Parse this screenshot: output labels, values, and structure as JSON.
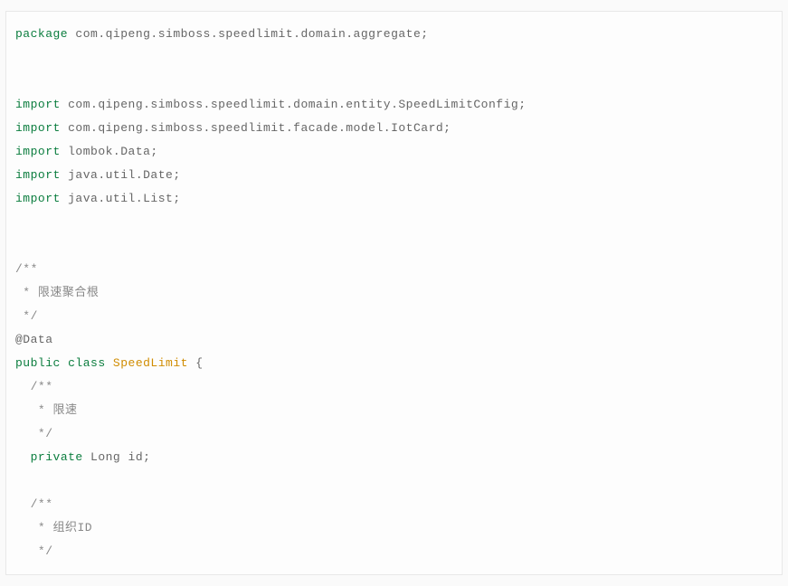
{
  "code": {
    "package_kw": "package",
    "package_name": " com.qipeng.simboss.speedlimit.domain.aggregate;",
    "import_kw": "import",
    "import1": " com.qipeng.simboss.speedlimit.domain.entity.SpeedLimitConfig;",
    "import2": " com.qipeng.simboss.speedlimit.facade.model.IotCard;",
    "import3": " lombok.Data;",
    "import4": " java.util.Date;",
    "import5": " java.util.List;",
    "block_comment_open": "/**",
    "block_comment_line1": " * 限速聚合根",
    "block_comment_close": " */",
    "annotation": "@Data",
    "public_kw": "public",
    "class_kw": " class ",
    "class_name": "SpeedLimit",
    "brace_open": " {",
    "field1_comment_open": "  /**",
    "field1_comment_line": "   * 限速",
    "field1_comment_close": "   */",
    "private_kw": "private",
    "field1_type": " Long",
    "field1_name": " id;",
    "field2_comment_open": "  /**",
    "field2_comment_line": "   * 组织ID",
    "field2_comment_close": "   */",
    "indent2": "  "
  }
}
